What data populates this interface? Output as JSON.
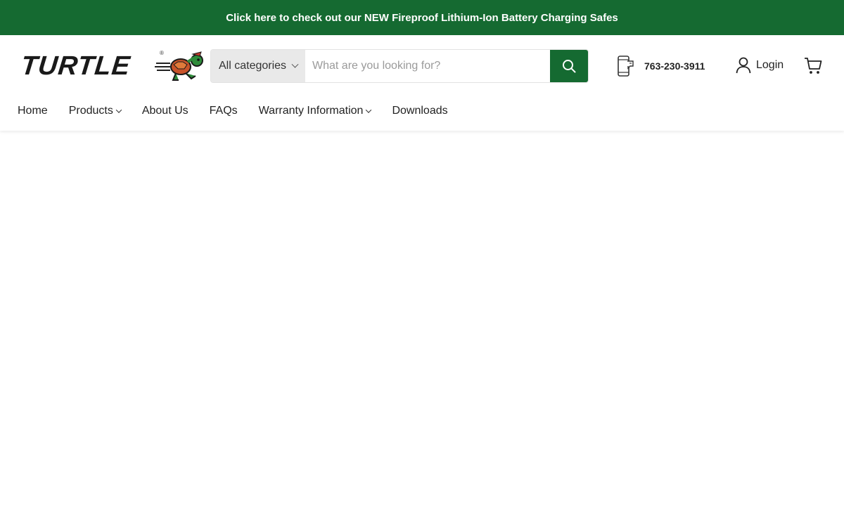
{
  "announcement": {
    "text": "Click here to check out our NEW Fireproof Lithium-Ion Battery Charging Safes"
  },
  "brand": {
    "logo_text": "TURTLE",
    "reg_mark": "®",
    "primary_color": "#156a31"
  },
  "search": {
    "category_label": "All categories",
    "placeholder": "What are you looking for?",
    "value": ""
  },
  "contact": {
    "phone": "763-230-3911"
  },
  "account": {
    "login_label": "Login"
  },
  "nav": {
    "items": [
      {
        "label": "Home",
        "has_dropdown": false
      },
      {
        "label": "Products",
        "has_dropdown": true
      },
      {
        "label": "About Us",
        "has_dropdown": false
      },
      {
        "label": "FAQs",
        "has_dropdown": false
      },
      {
        "label": "Warranty Information",
        "has_dropdown": true
      },
      {
        "label": "Downloads",
        "has_dropdown": false
      }
    ]
  },
  "icons": {
    "search": "search-icon",
    "phone": "phone-icon",
    "user": "user-icon",
    "cart": "cart-icon",
    "chevron": "chevron-down-icon"
  }
}
